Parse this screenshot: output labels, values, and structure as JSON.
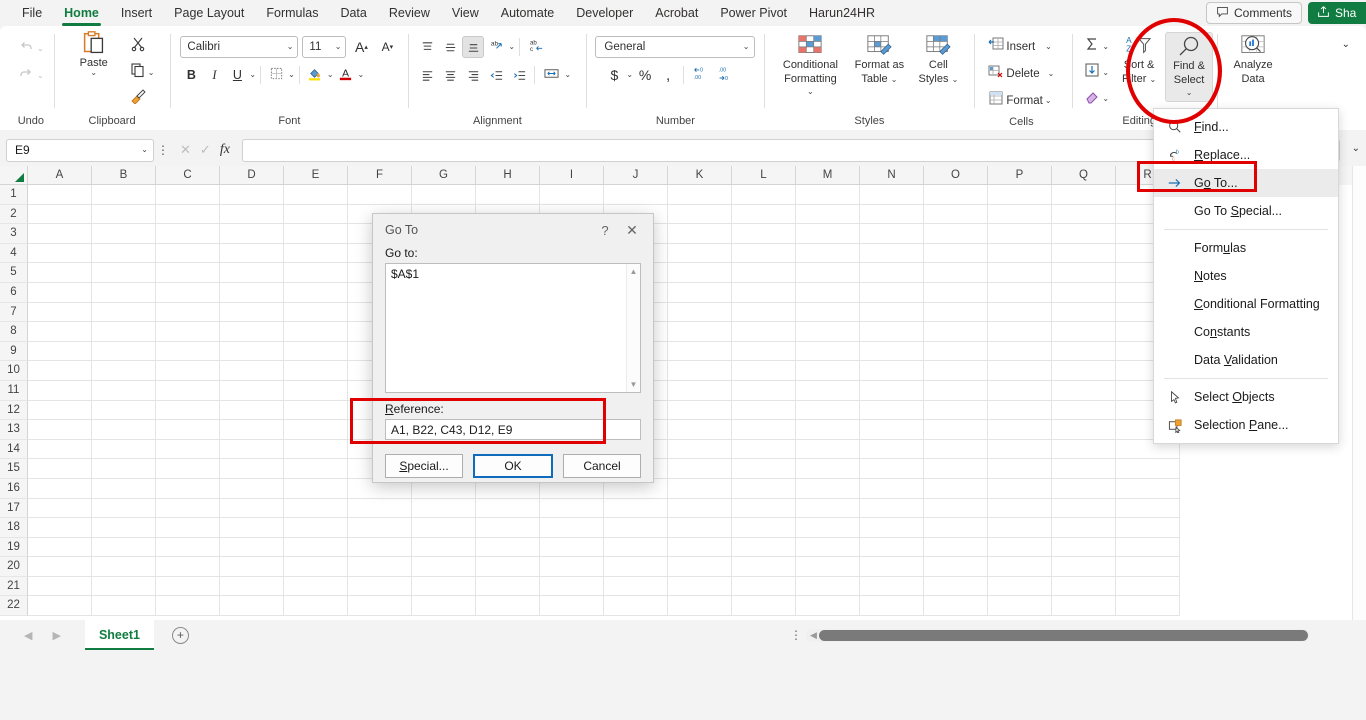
{
  "window": {
    "tabs": [
      {
        "label": "File",
        "active": false
      },
      {
        "label": "Home",
        "active": true
      },
      {
        "label": "Insert",
        "active": false
      },
      {
        "label": "Page Layout",
        "active": false
      },
      {
        "label": "Formulas",
        "active": false
      },
      {
        "label": "Data",
        "active": false
      },
      {
        "label": "Review",
        "active": false
      },
      {
        "label": "View",
        "active": false
      },
      {
        "label": "Automate",
        "active": false
      },
      {
        "label": "Developer",
        "active": false
      },
      {
        "label": "Acrobat",
        "active": false
      },
      {
        "label": "Power Pivot",
        "active": false
      },
      {
        "label": "Harun24HR",
        "active": false
      }
    ],
    "comments_label": "Comments",
    "share_label": "Sha",
    "accent_green": "#107c41",
    "annotation_red": "#e00000"
  },
  "ribbon": {
    "groups": {
      "undo": {
        "label": "Undo",
        "undo_icon": "undo-arrow-icon",
        "redo_icon": "redo-arrow-icon"
      },
      "clipboard": {
        "label": "Clipboard",
        "paste_label": "Paste",
        "cut_icon": "scissors-icon",
        "copy_icon": "copy-icon",
        "format_painter_icon": "format-painter-icon"
      },
      "font": {
        "label": "Font",
        "font_name": "Calibri",
        "font_size": "11",
        "grow_font": "A",
        "shrink_font": "A",
        "bold": "B",
        "italic": "I",
        "underline": "U",
        "borders_icon": "borders-icon",
        "fill_color_icon": "fill-color-icon",
        "font_color_icon": "font-color-icon"
      },
      "alignment": {
        "label": "Alignment",
        "orientation_icon": "orientation-icon",
        "wrap_text_icon": "wrap-text-icon",
        "merge_icon": "merge-center-icon"
      },
      "number": {
        "label": "Number",
        "format": "General",
        "currency": "$",
        "percent": "%",
        "comma": ",",
        "inc_decimal_icon": "increase-decimal-icon",
        "dec_decimal_icon": "decrease-decimal-icon"
      },
      "styles": {
        "label": "Styles",
        "conditional_formatting": "Conditional\nFormatting",
        "conditional_formatting_l1": "Conditional",
        "conditional_formatting_l2": "Formatting",
        "format_as_table_l1": "Format as",
        "format_as_table_l2": "Table",
        "cell_styles_l1": "Cell",
        "cell_styles_l2": "Styles"
      },
      "cells": {
        "label": "Cells",
        "insert": "Insert",
        "delete": "Delete",
        "format": "Format"
      },
      "editing": {
        "label": "Editing",
        "autosum_icon": "sigma-icon",
        "fill_icon": "fill-down-icon",
        "clear_icon": "eraser-icon",
        "sort_filter_l1": "Sort &",
        "sort_filter_l2": "Filter",
        "find_select_l1": "Find &",
        "find_select_l2": "Select"
      },
      "analysis": {
        "label": "",
        "analyze_l1": "Analyze",
        "analyze_l2": "Data"
      }
    }
  },
  "formula_bar": {
    "name_box_value": "E9",
    "cancel_icon": "cancel-x-icon",
    "enter_icon": "enter-check-icon",
    "function_icon": "fx-icon",
    "formula_value": ""
  },
  "grid": {
    "columns": [
      "A",
      "B",
      "C",
      "D",
      "E",
      "F",
      "G",
      "H",
      "I",
      "J",
      "K",
      "L",
      "M",
      "N",
      "O",
      "P",
      "Q",
      "R"
    ],
    "rows": [
      "1",
      "2",
      "3",
      "4",
      "5",
      "6",
      "7",
      "8",
      "9",
      "10",
      "11",
      "12",
      "13",
      "14",
      "15",
      "16",
      "17",
      "18",
      "19",
      "20",
      "21",
      "22"
    ]
  },
  "sheet_bar": {
    "prev_icon": "prev-sheet-icon",
    "next_icon": "next-sheet-icon",
    "sheets": [
      {
        "label": "Sheet1",
        "active": true
      }
    ],
    "add_sheet_label": "+"
  },
  "find_select_menu": {
    "items": [
      {
        "label": "Find...",
        "pre": "",
        "accel": "F",
        "post": "ind...",
        "icon": "magnifier-icon",
        "highlighted": false,
        "separator_after": false
      },
      {
        "label": "Replace...",
        "pre": "",
        "accel": "R",
        "post": "eplace...",
        "icon": "replace-icon",
        "highlighted": false,
        "separator_after": false
      },
      {
        "label": "Go To...",
        "pre": "G",
        "accel": "o",
        "post": " To...",
        "icon": "goto-arrow-icon",
        "highlighted": true,
        "separator_after": false
      },
      {
        "label": "Go To Special...",
        "pre": "Go To ",
        "accel": "S",
        "post": "pecial...",
        "icon": "",
        "highlighted": false,
        "separator_after": true
      },
      {
        "label": "Formulas",
        "pre": "Form",
        "accel": "u",
        "post": "las",
        "icon": "",
        "highlighted": false,
        "separator_after": false
      },
      {
        "label": "Notes",
        "pre": "",
        "accel": "N",
        "post": "otes",
        "icon": "",
        "highlighted": false,
        "separator_after": false
      },
      {
        "label": "Conditional Formatting",
        "pre": "",
        "accel": "C",
        "post": "onditional Formatting",
        "icon": "",
        "highlighted": false,
        "separator_after": false
      },
      {
        "label": "Constants",
        "pre": "Co",
        "accel": "n",
        "post": "stants",
        "icon": "",
        "highlighted": false,
        "separator_after": false
      },
      {
        "label": "Data Validation",
        "pre": "Data ",
        "accel": "V",
        "post": "alidation",
        "icon": "",
        "highlighted": false,
        "separator_after": true
      },
      {
        "label": "Select Objects",
        "pre": "Select ",
        "accel": "O",
        "post": "bjects",
        "icon": "cursor-arrow-icon",
        "highlighted": false,
        "separator_after": false
      },
      {
        "label": "Selection Pane...",
        "pre": "Selection ",
        "accel": "P",
        "post": "ane...",
        "icon": "selection-pane-icon",
        "highlighted": false,
        "separator_after": false
      }
    ]
  },
  "goto_dialog": {
    "title": "Go To",
    "help_glyph": "?",
    "close_glyph": "✕",
    "goto_label": "Go to:",
    "list_items": [
      "$A$1"
    ],
    "reference_label_pre": "R",
    "reference_label_post": "eference:",
    "reference_value": "A1, B22, C43, D12, E9",
    "special_pre": "S",
    "special_post": "pecial...",
    "ok_label": "OK",
    "cancel_label": "Cancel"
  },
  "annotations": {
    "circle_target": "find-and-select-button",
    "rect_goto_menu_target": "menu-item-go-to",
    "rect_reference_target": "reference-field-group"
  }
}
